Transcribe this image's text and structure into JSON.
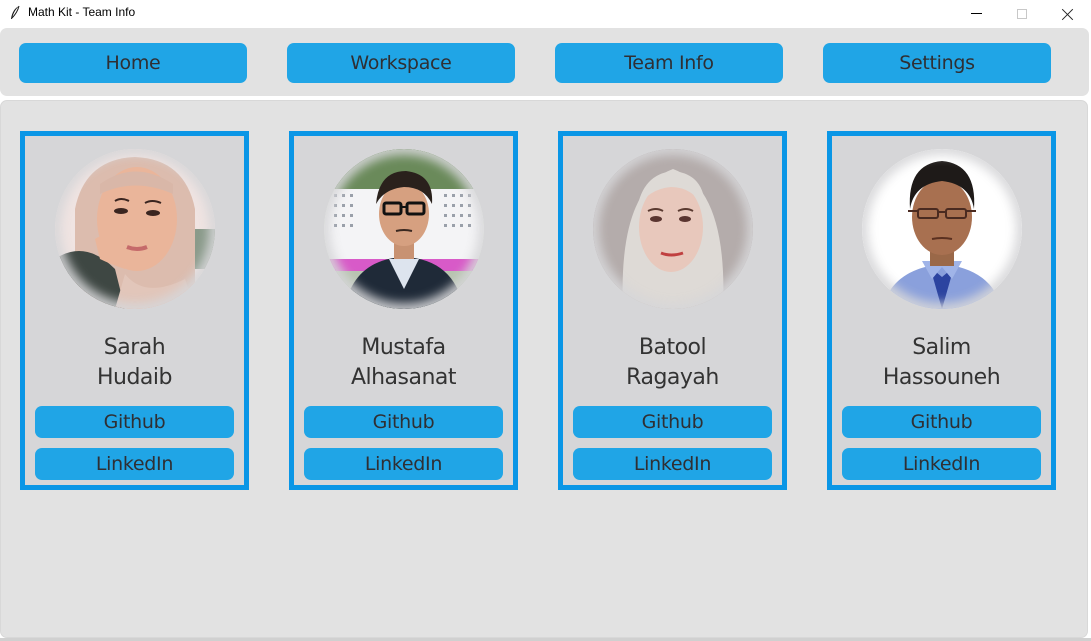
{
  "window": {
    "title": "Math Kit - Team Info",
    "app_icon": "feather-icon",
    "controls": [
      "minimize",
      "maximize",
      "close"
    ]
  },
  "nav": {
    "items": [
      {
        "label": "Home"
      },
      {
        "label": "Workspace"
      },
      {
        "label": "Team Info"
      },
      {
        "label": "Settings"
      }
    ]
  },
  "team": {
    "members": [
      {
        "first_name": "Sarah",
        "last_name": "Hudaib",
        "github_label": "Github",
        "linkedin_label": "LinkedIn",
        "photo": "profile-photo"
      },
      {
        "first_name": "Mustafa",
        "last_name": "Alhasanat",
        "github_label": "Github",
        "linkedin_label": "LinkedIn",
        "photo": "profile-photo"
      },
      {
        "first_name": "Batool",
        "last_name": "Ragayah",
        "github_label": "Github",
        "linkedin_label": "LinkedIn",
        "photo": "profile-photo"
      },
      {
        "first_name": "Salim",
        "last_name": "Hassouneh",
        "github_label": "Github",
        "linkedin_label": "LinkedIn",
        "photo": "profile-photo"
      }
    ]
  },
  "colors": {
    "accent": "#20a5e6",
    "card_border": "#0a96e6",
    "panel_bg": "#e2e2e2",
    "card_bg": "#d6d6d8",
    "text": "#2f2f33"
  }
}
